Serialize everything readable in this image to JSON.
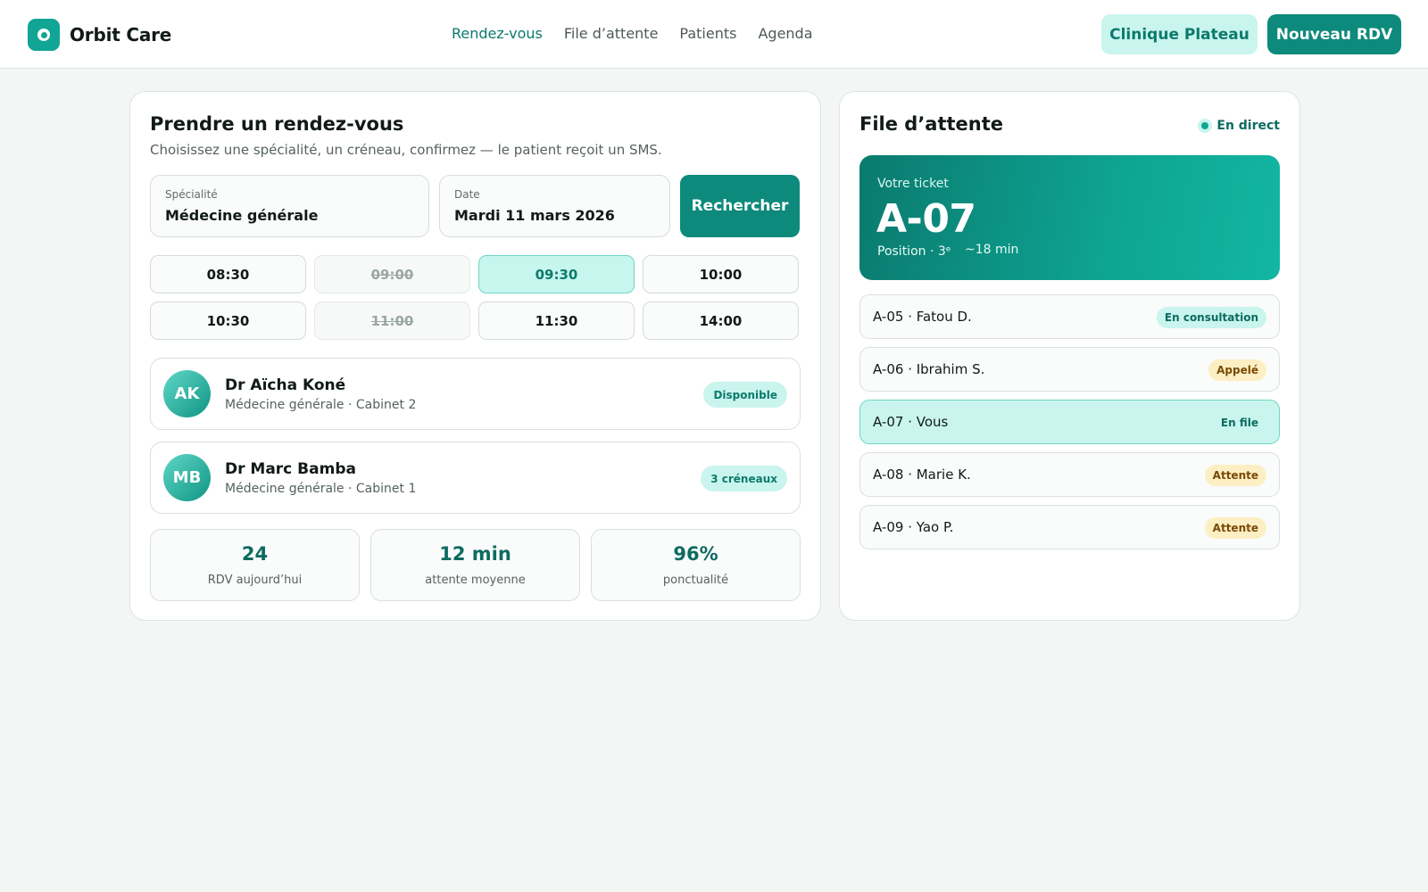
{
  "brand": {
    "name": "Orbit Care",
    "icon": "orbit-logo-icon",
    "accent": "#10a594"
  },
  "nav": {
    "items": [
      {
        "label": "Rendez-vous",
        "active": true
      },
      {
        "label": "File d’attente",
        "active": false
      },
      {
        "label": "Patients",
        "active": false
      },
      {
        "label": "Agenda",
        "active": false
      }
    ]
  },
  "header": {
    "clinic_label": "Clinique Plateau",
    "new_label": "Nouveau RDV"
  },
  "booking": {
    "title": "Prendre un rendez-vous",
    "subtitle": "Choisissez une spécialité, un créneau, confirmez — le patient reçoit un SMS.",
    "specialty": {
      "label": "Spécialité",
      "value": "Médecine générale"
    },
    "date": {
      "label": "Date",
      "value": "Mardi 11 mars 2026"
    },
    "search_label": "Rechercher",
    "slots": [
      {
        "time": "08:30",
        "state": "available"
      },
      {
        "time": "09:00",
        "state": "taken"
      },
      {
        "time": "09:30",
        "state": "selected"
      },
      {
        "time": "10:00",
        "state": "available"
      },
      {
        "time": "10:30",
        "state": "available"
      },
      {
        "time": "11:00",
        "state": "taken"
      },
      {
        "time": "11:30",
        "state": "available"
      },
      {
        "time": "14:00",
        "state": "available"
      }
    ],
    "doctors": [
      {
        "initials": "AK",
        "name": "Dr Aïcha Koné",
        "meta": "Médecine générale · Cabinet 2",
        "status": "Disponible"
      },
      {
        "initials": "MB",
        "name": "Dr Marc Bamba",
        "meta": "Médecine générale · Cabinet 1",
        "status": "3 créneaux"
      }
    ],
    "stats": [
      {
        "value": "24",
        "caption": "RDV aujourd’hui"
      },
      {
        "value": "12 min",
        "caption": "attente moyenne"
      },
      {
        "value": "96%",
        "caption": "ponctualité"
      }
    ]
  },
  "queue": {
    "title": "File d’attente",
    "live_label": "En direct",
    "ticket": {
      "label": "Votre ticket",
      "number": "A-07",
      "position": "Position · 3ᵉ",
      "eta": "~18 min"
    },
    "rows": [
      {
        "text": "A-05 · Fatou D.",
        "status": "En consultation",
        "tone": "teal"
      },
      {
        "text": "A-06 · Ibrahim S.",
        "status": "Appelé",
        "tone": "amber"
      },
      {
        "text": "A-07 · Vous",
        "status": "En file",
        "tone": "plain",
        "me": true
      },
      {
        "text": "A-08 · Marie K.",
        "status": "Attente",
        "tone": "amber"
      },
      {
        "text": "A-09 · Yao P.",
        "status": "Attente",
        "tone": "amber"
      }
    ]
  }
}
